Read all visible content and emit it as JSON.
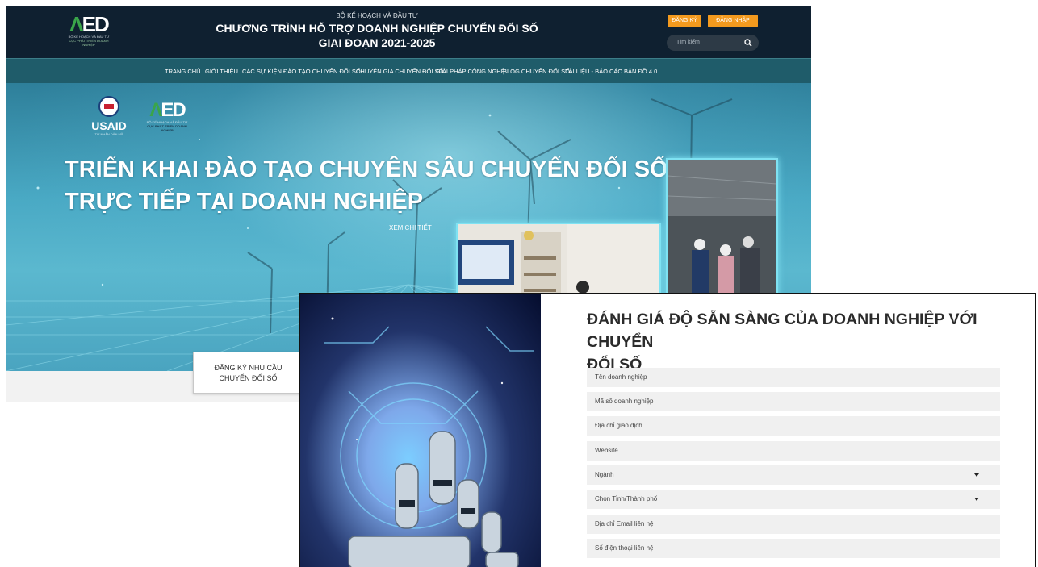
{
  "site": {
    "logo": {
      "mark": "ED",
      "sub1": "BỘ KẾ HOẠCH VÀ ĐẦU TƯ",
      "sub2": "CỤC PHÁT TRIỂN DOANH NGHIỆP"
    },
    "ministry": "BỘ KẾ HOẠCH VÀ ĐẦU TƯ",
    "program_title": "CHƯƠNG TRÌNH HỖ TRỢ DOANH NGHIỆP CHUYỂN ĐỔI SỐ",
    "program_period": "GIAI ĐOẠN 2021-2025",
    "register_label": "ĐĂNG KÝ",
    "login_label": "ĐĂNG NHẬP",
    "search_placeholder": "Tìm kiếm",
    "nav": [
      "TRANG CHỦ",
      "GIỚI THIỆU",
      "CÁC SỰ KIỆN",
      "ĐÀO TẠO CHUYỂN ĐỔI SỐ",
      "CHUYÊN GIA CHUYỂN ĐỔI SỐ",
      "GIẢI PHÁP CÔNG NGHỆ",
      "BLOG CHUYỂN ĐỔI SỐ",
      "TÀI LIỆU - BÁO CÁO",
      "BẢN ĐỒ 4.0"
    ],
    "hero": {
      "usaid": "USAID",
      "usaid_tag": "TỪ NHÂN DÂN MỸ",
      "aed_mark": "ED",
      "aed_sub1": "BỘ KẾ HOẠCH VÀ ĐẦU TƯ",
      "aed_sub2": "CỤC PHÁT TRIỂN DOANH NGHIỆP",
      "headline_1": "TRIỂN KHAI ĐÀO TẠO CHUYÊN SÂU CHUYỂN ĐỔI SỐ",
      "headline_2": "TRỰC TIẾP TẠI DOANH NGHIỆP",
      "see_more": "XEM CHI TIẾT"
    },
    "register_card": {
      "line1": "ĐĂNG KÝ NHU CẦU",
      "line2": "CHUYỂN ĐỔI SỐ"
    }
  },
  "form": {
    "title_1": "ĐÁNH GIÁ ĐỘ SẴN SÀNG CỦA DOANH NGHIỆP VỚI CHUYỂN",
    "title_2": "ĐỔI SỐ",
    "fields": [
      {
        "label": "Tên doanh nghiệp",
        "type": "text"
      },
      {
        "label": "Mã số doanh nghiệp",
        "type": "text"
      },
      {
        "label": "Địa chỉ giao dịch",
        "type": "text"
      },
      {
        "label": "Website",
        "type": "text"
      },
      {
        "label": "Ngành",
        "type": "select"
      },
      {
        "label": "Chọn Tỉnh/Thành phố",
        "type": "select"
      },
      {
        "label": "Địa chỉ Email liên hệ",
        "type": "text"
      },
      {
        "label": "Số điện thoại liên hệ",
        "type": "text"
      }
    ]
  },
  "colors": {
    "header_bg": "#0f2030",
    "nav_bg": "#1f5c6a",
    "accent_orange": "#f39a1e",
    "field_bg": "#f0f0f0"
  },
  "icons": {
    "search": "search-icon",
    "dropdown": "caret-down-icon"
  }
}
